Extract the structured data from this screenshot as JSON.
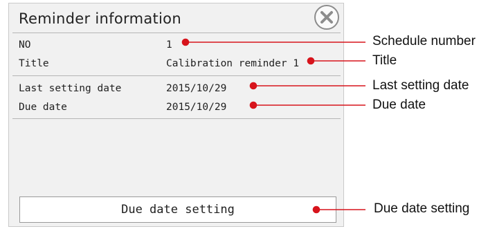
{
  "dialog": {
    "title": "Reminder information",
    "close_icon": "close-circle-x-icon",
    "rows": [
      {
        "label": "NO",
        "value": "1"
      },
      {
        "label": "Title",
        "value": "Calibration reminder 1"
      },
      {
        "label": "Last setting date",
        "value": "2015/10/29"
      },
      {
        "label": "Due date",
        "value": "2015/10/29"
      }
    ],
    "button_label": "Due date setting"
  },
  "callouts": {
    "schedule_number": "Schedule number",
    "title": "Title",
    "last_setting_date": "Last setting date",
    "due_date": "Due date",
    "due_date_setting": "Due date setting"
  },
  "colors": {
    "callout_red": "#d7141c",
    "panel_bg": "#f1f1f1"
  }
}
